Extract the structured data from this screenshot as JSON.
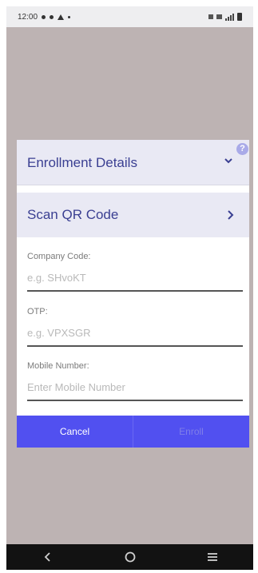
{
  "status_bar": {
    "time": "12:00"
  },
  "enrollment": {
    "title": "Enrollment Details",
    "help_label": "?"
  },
  "scan": {
    "title": "Scan QR Code"
  },
  "fields": [
    {
      "label": "Company Code:",
      "placeholder": "e.g. SHvoKT",
      "value": ""
    },
    {
      "label": "OTP:",
      "placeholder": "e.g. VPXSGR",
      "value": ""
    },
    {
      "label": "Mobile Number:",
      "placeholder": "Enter Mobile Number",
      "value": ""
    }
  ],
  "actions": {
    "cancel_label": "Cancel",
    "enroll_label": "Enroll"
  },
  "colors": {
    "accent": "#5150f0",
    "title": "#3a3f92",
    "backdrop": "#bdb3b3"
  },
  "icons": {
    "expand": "chevron-down-icon",
    "next": "chevron-right-icon",
    "help": "help-icon",
    "nav_back": "back-icon",
    "nav_home": "home-icon",
    "nav_menu": "menu-icon"
  }
}
